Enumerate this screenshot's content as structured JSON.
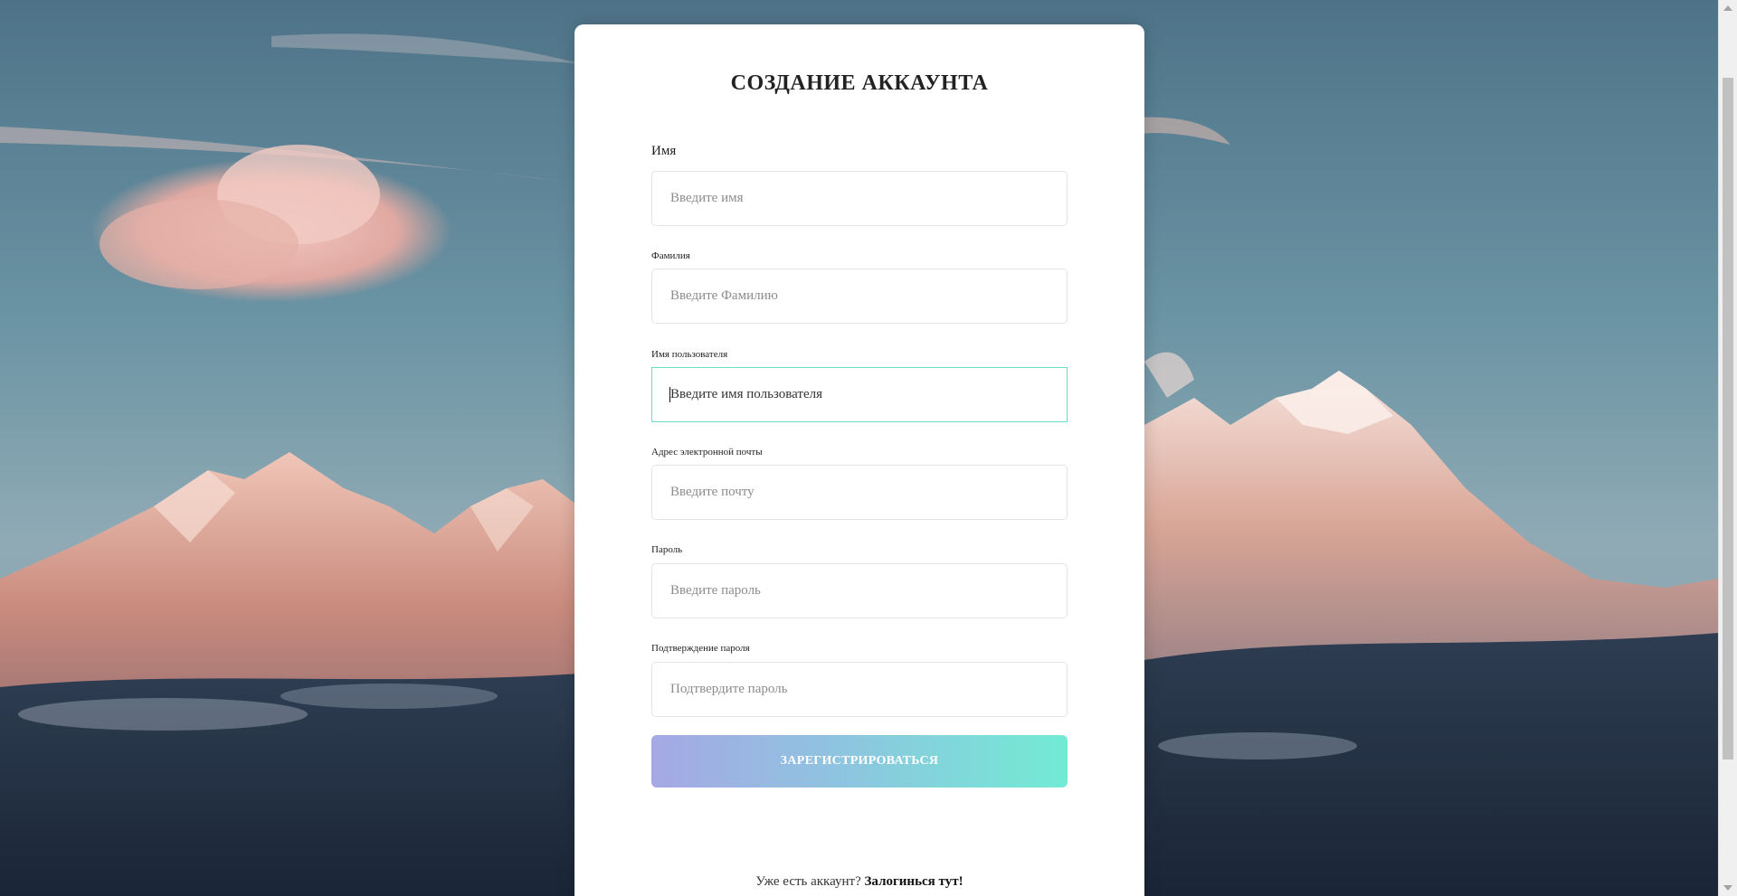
{
  "form": {
    "title": "СОЗДАНИЕ АККАУНТА",
    "fields": [
      {
        "label": "Имя",
        "placeholder": "Введите имя",
        "value": ""
      },
      {
        "label": "Фамилия",
        "placeholder": "Введите Фамилию",
        "value": ""
      },
      {
        "label": "Имя пользователя",
        "placeholder": "Введите имя пользователя",
        "value": "",
        "focused": true
      },
      {
        "label": "Адрес электронной почты",
        "placeholder": "Введите почту",
        "value": ""
      },
      {
        "label": "Пароль",
        "placeholder": "Введите пароль",
        "value": ""
      },
      {
        "label": "Подтверждение пароля",
        "placeholder": "Подтвердите пароль",
        "value": ""
      }
    ],
    "submit_label": "ЗАРЕГИСТРИРОВАТЬСЯ",
    "login_prompt": "Уже есть аккаунт?",
    "login_link": "Залогинься тут!"
  },
  "colors": {
    "card": "#ffffff",
    "focus_border": "#6fdcd3",
    "button_gradient_start": "#a6a8e4",
    "button_gradient_end": "#72ebd4"
  }
}
